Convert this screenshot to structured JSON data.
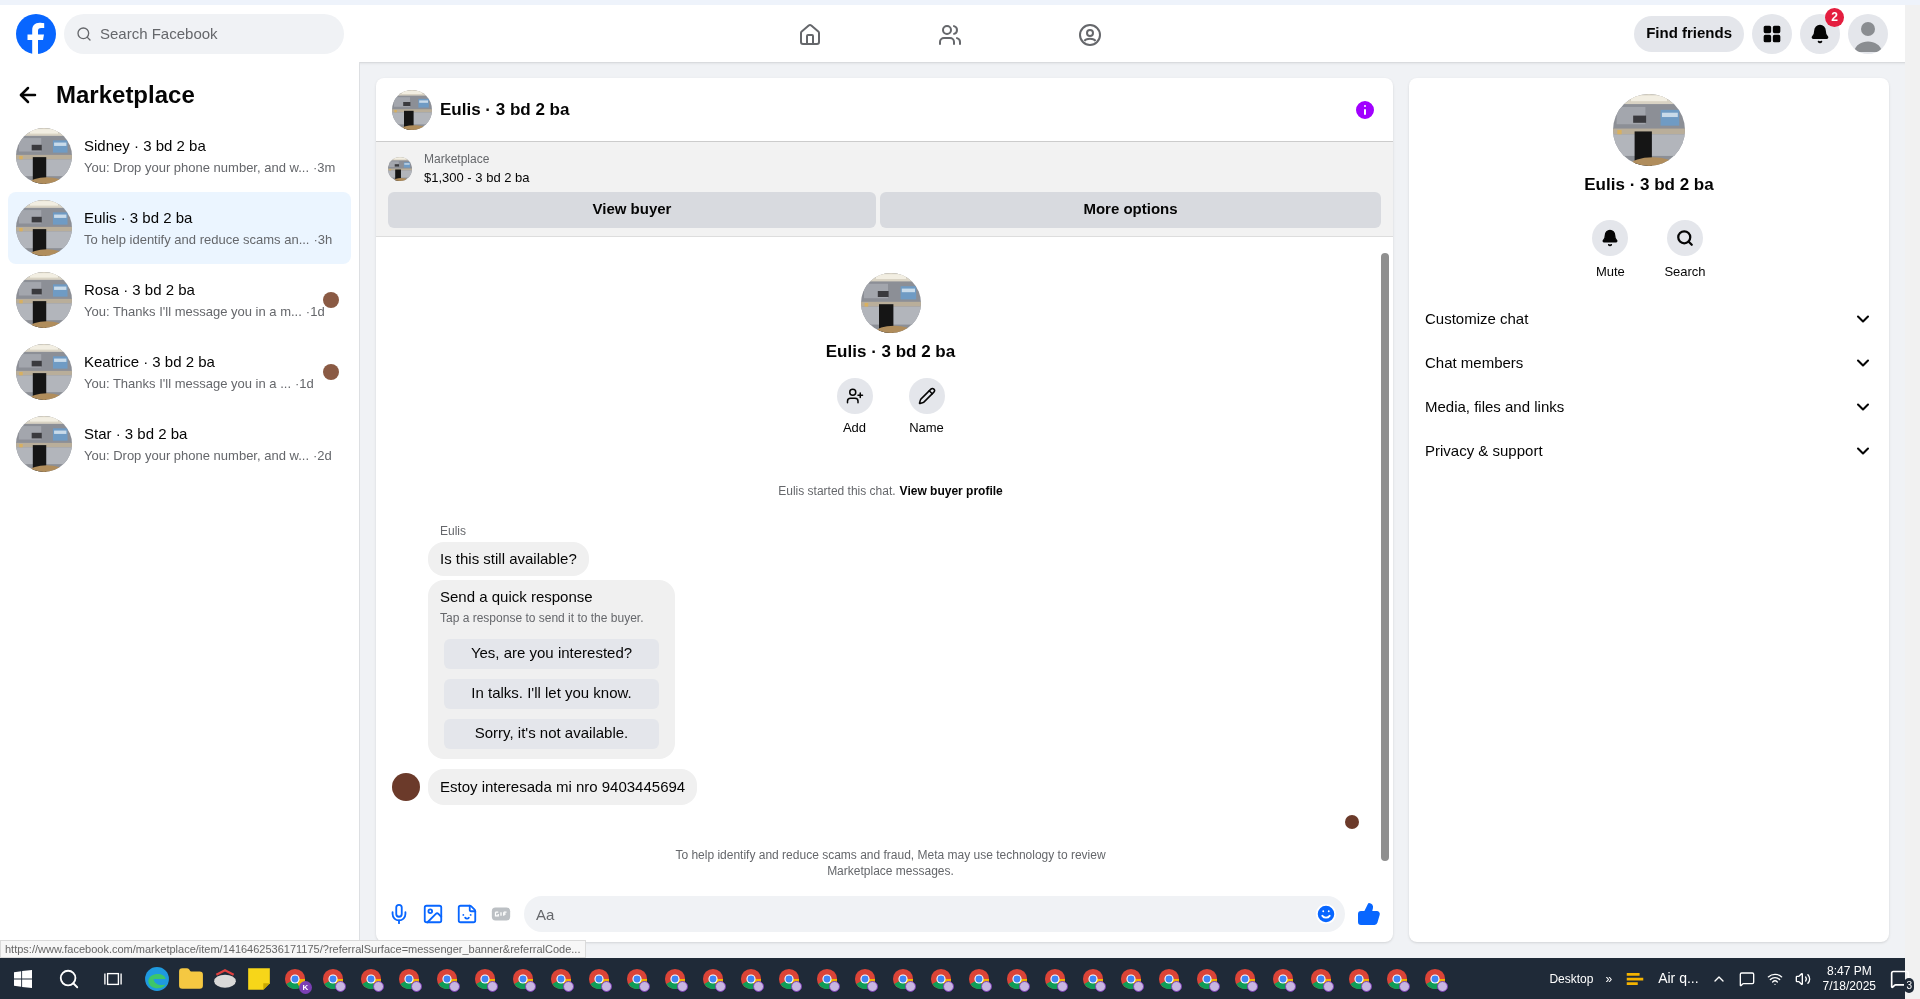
{
  "top_bar": {
    "search_placeholder": "Search Facebook",
    "find_friends": "Find friends",
    "notification_count": "2"
  },
  "sidebar": {
    "title": "Marketplace",
    "conversations": [
      {
        "title": "Sidney · 3 bd 2 ba",
        "preview": "You: Drop your phone number, and w...",
        "time": "·3m",
        "selected": false,
        "seen": false
      },
      {
        "title": "Eulis · 3 bd 2 ba",
        "preview": "To help identify and reduce scams an...",
        "time": "·3h",
        "selected": true,
        "seen": false
      },
      {
        "title": "Rosa · 3 bd 2 ba",
        "preview": "You: Thanks I'll message you in a m...",
        "time": "·1d",
        "selected": false,
        "seen": true
      },
      {
        "title": "Keatrice · 3 bd 2 ba",
        "preview": "You: Thanks I'll message you in a ...",
        "time": "·1d",
        "selected": false,
        "seen": true
      },
      {
        "title": "Star · 3 bd 2 ba",
        "preview": "You: Drop your phone number, and w...",
        "time": "·2d",
        "selected": false,
        "seen": false
      }
    ]
  },
  "chat": {
    "title": "Eulis · 3 bd 2 ba",
    "listing": {
      "label": "Marketplace",
      "price": "$1,300 - 3 bd 2 ba"
    },
    "actions": [
      "View buyer",
      "More options"
    ],
    "profile": {
      "name": "Eulis · 3 bd 2 ba",
      "actions": [
        {
          "kind": "add",
          "label": "Add"
        },
        {
          "kind": "name",
          "label": "Name"
        }
      ]
    },
    "started": "Eulis started this chat.",
    "started_link": "View buyer profile",
    "sender": "Eulis",
    "first_message": "Is this still available?",
    "quick_response": {
      "title": "Send a quick response",
      "hint": "Tap a response to send it to the buyer.",
      "options": [
        "Yes, are you interested?",
        "In talks. I'll let you know.",
        "Sorry, it's not available."
      ]
    },
    "last_message": "Estoy interesada mi nro 9403445694",
    "notice": "To help identify and reduce scams and fraud, Meta may use technology to review Marketplace messages.",
    "composer_placeholder": "Aa"
  },
  "details": {
    "name": "Eulis · 3 bd 2 ba",
    "actions": [
      {
        "kind": "mute",
        "label": "Mute"
      },
      {
        "kind": "search",
        "label": "Search"
      }
    ],
    "sections": [
      "Customize chat",
      "Chat members",
      "Media, files and links",
      "Privacy & support"
    ]
  },
  "status_url": "https://www.facebook.com/marketplace/item/1416462536171175/?referralSurface=messenger_banner&referralCode...",
  "taskbar": {
    "profile_badge": "K",
    "desktop": "Desktop",
    "more": "»",
    "weather": "Air q...",
    "time": "8:47 PM",
    "date": "7/18/2025",
    "notifications": "3"
  }
}
